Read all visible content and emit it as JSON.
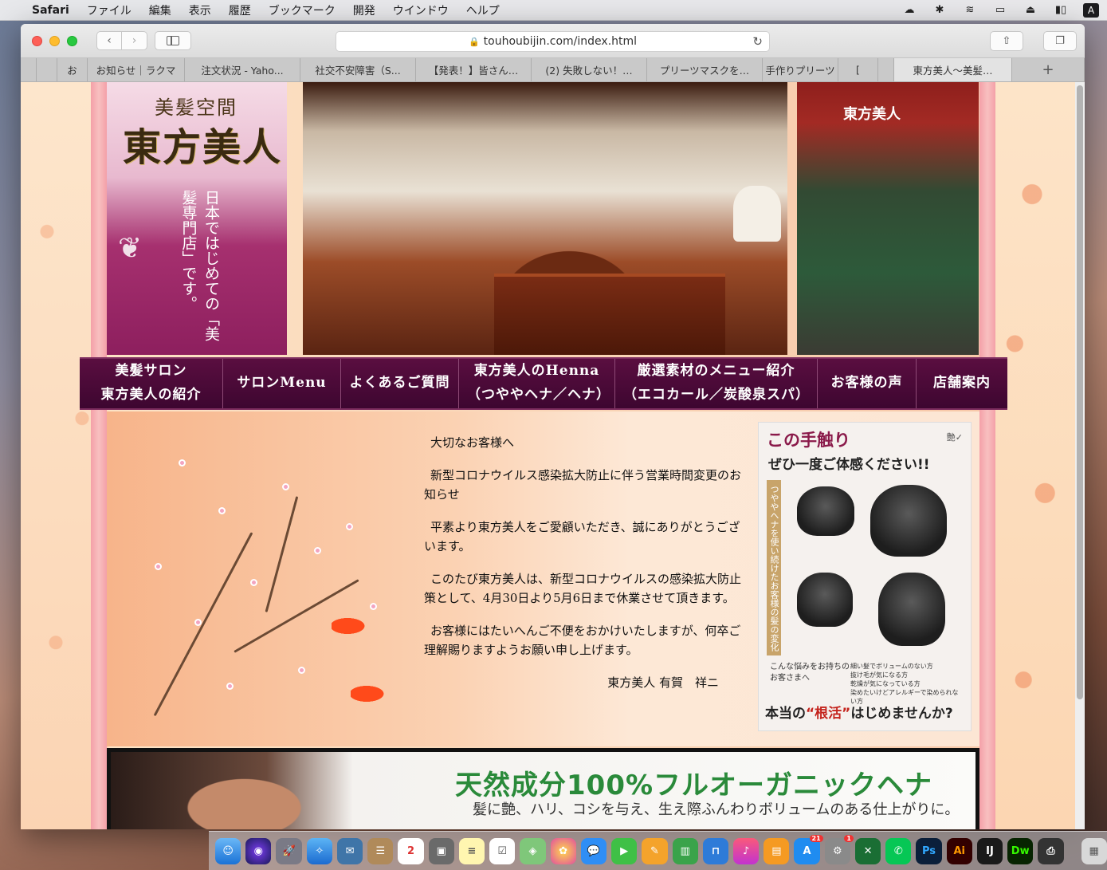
{
  "menubar": {
    "app_name": "Safari",
    "items": [
      "ファイル",
      "編集",
      "表示",
      "履歴",
      "ブックマーク",
      "開発",
      "ウインドウ",
      "ヘルプ"
    ],
    "user_initial": "A"
  },
  "toolbar": {
    "url": "touhoubijin.com/index.html"
  },
  "tabs": [
    {
      "label": "お"
    },
    {
      "label": "お知らせ｜ラクマ"
    },
    {
      "label": "注文状況 - Yaho..."
    },
    {
      "label": "社交不安障害（S..."
    },
    {
      "label": "【発表！】皆さん…"
    },
    {
      "label": "(2) 失敗しない！…"
    },
    {
      "label": "プリーツマスクを…"
    },
    {
      "label": "手作りプリーツ"
    },
    {
      "label": "["
    },
    {
      "label": "東方美人〜美髪…"
    }
  ],
  "header": {
    "logo_small": "美髪空間",
    "logo_big": "東方美人",
    "logo_tagline": "日本ではじめての「美髪専門店」です。",
    "store_sign": "東方美人"
  },
  "nav": [
    {
      "line1": "美髪サロン",
      "line2": "東方美人の紹介"
    },
    {
      "line1": "サロンMenu",
      "line2": ""
    },
    {
      "line1": "よくあるご質問",
      "line2": ""
    },
    {
      "line1": "東方美人のHenna",
      "line2": "（つややヘナ／ヘナ）"
    },
    {
      "line1": "厳選素材のメニュー紹介",
      "line2": "（エコカール／炭酸泉スパ）"
    },
    {
      "line1": "お客様の声",
      "line2": ""
    },
    {
      "line1": "店舗案内",
      "line2": ""
    }
  ],
  "notice": {
    "greeting": "大切なお客様へ",
    "subject": "新型コロナウイルス感染拡大防止に伴う営業時間変更のお知らせ",
    "para1": "平素より東方美人をご愛顧いただき、誠にありがとうございます。",
    "para2": "このたび東方美人は、新型コロナウイルスの感染拡大防止策として、4月30日より5月6日まで休業させて頂きます。",
    "para3": "お客様にはたいへんご不便をおかけいたしますが、何卒ご理解賜りますようお願い申し上げます。",
    "signature": "東方美人 有賀　祥ニ"
  },
  "ad": {
    "title": "この手触り",
    "subtitle": "ぜひ一度ご体感ください!!",
    "badge": "艶✓",
    "vertical": "つややヘナを使い続けたお客様の髪の変化",
    "note": "こんな悩みをお持ちのお客さまへ",
    "checks": [
      "細い髪でボリュームのない方",
      "抜け毛が気になる方",
      "乾燥が気になっている方",
      "染めたいけどアレルギーで染められない方"
    ],
    "footer_prefix": "本当の",
    "footer_accent": "“根活”",
    "footer_suffix": "はじめませんか?"
  },
  "banner": {
    "title": "天然成分100%フルオーガニックヘナ",
    "subtitle": "髪に艶、ハリ、コシを与え、生え際ふんわりボリュームのある仕上がりに。"
  },
  "dock": {
    "calendar_day": "2",
    "badges": {
      "appstore": "21",
      "settings": "1"
    },
    "labels": [
      "Ps",
      "Ai",
      "Dw"
    ]
  },
  "colors": {
    "nav_bg": "#4a0a36",
    "notice_text": "#111111",
    "banner_title": "#2a8a3a",
    "ad_accent": "#c4231c"
  }
}
